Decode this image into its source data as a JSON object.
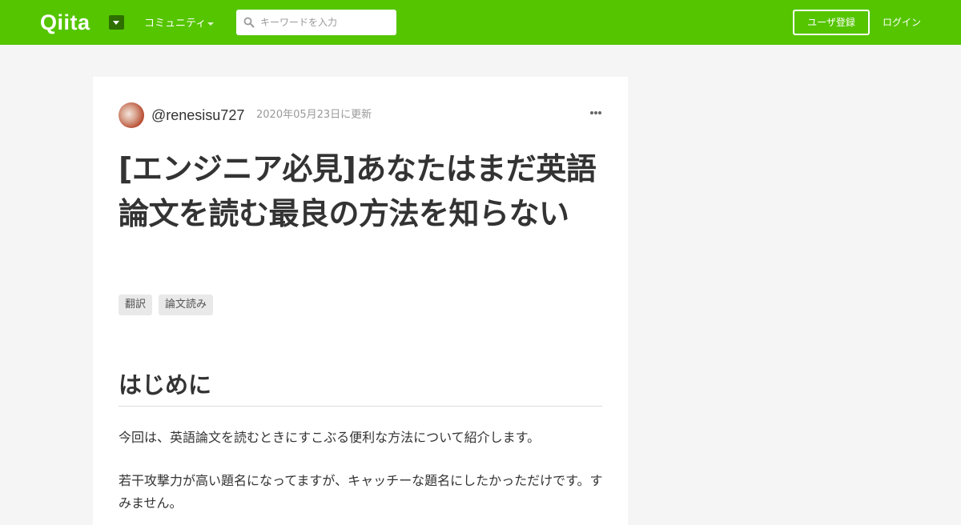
{
  "header": {
    "logo": "Qiita",
    "community_label": "コミュニティ",
    "search_placeholder": "キーワードを入力",
    "signup_label": "ユーザ登録",
    "login_label": "ログイン"
  },
  "article": {
    "author": "@renesisu727",
    "updated": "2020年05月23日に更新",
    "title": "[エンジニア必見]あなたはまだ英語論文を読む最良の方法を知らない",
    "tags": [
      "翻訳",
      "論文読み"
    ],
    "heading": "はじめに",
    "paragraphs": [
      "今回は、英語論文を読むときにすこぶる便利な方法について紹介します。",
      "若干攻撃力が高い題名になってますが、キャッチーな題名にしたかっただけです。すみません。"
    ]
  },
  "colors": {
    "brand": "#55c500",
    "brand_dark": "#2e6f00",
    "background": "#f5f5f5"
  },
  "icons": [
    "caret-down-icon",
    "search-icon",
    "more-icon"
  ]
}
